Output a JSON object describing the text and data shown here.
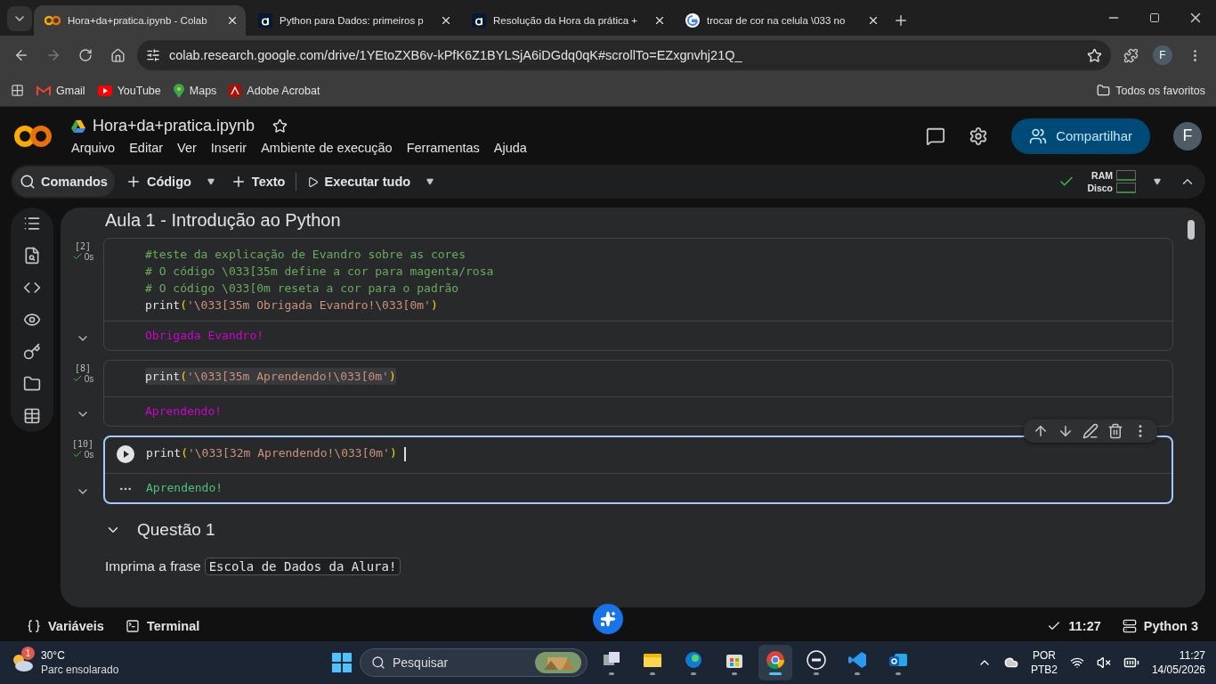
{
  "browser": {
    "tabs": [
      {
        "kind": "colab",
        "title": "Hora+da+pratica.ipynb - Colab",
        "selected": true
      },
      {
        "kind": "alura",
        "title": "Python para Dados: primeiros p",
        "selected": false
      },
      {
        "kind": "alura",
        "title": "Resolução da Hora da prática +",
        "selected": false
      },
      {
        "kind": "google",
        "title": "trocar de cor na celula \\033 no",
        "selected": false
      }
    ],
    "url": "colab.research.google.com/drive/1YEtoZXB6v-kPfK6Z1BYLSjA6iDGdq0qK#scrollTo=EZxgnvhj21Q_",
    "profile": "F",
    "bookmarks": [
      {
        "kind": "gmail",
        "label": "Gmail"
      },
      {
        "kind": "youtube",
        "label": "YouTube"
      },
      {
        "kind": "maps",
        "label": "Maps"
      },
      {
        "kind": "acrobat",
        "label": "Adobe Acrobat"
      }
    ],
    "all_bookmarks": "Todos os favoritos"
  },
  "colab": {
    "title": "Hora+da+pratica.ipynb",
    "menu": [
      "Arquivo",
      "Editar",
      "Ver",
      "Inserir",
      "Ambiente de execução",
      "Ferramentas",
      "Ajuda"
    ],
    "share": "Compartilhar",
    "avatar": "F",
    "toolbar": {
      "commands": "Comandos",
      "code": "Código",
      "text": "Texto",
      "run_all": "Executar tudo",
      "ram": "RAM",
      "disk": "Disco"
    }
  },
  "notebook": {
    "heading": "Aula 1 - Introdução ao Python",
    "cells": [
      {
        "count": "[2]",
        "time": "0s",
        "selected": false,
        "lines": [
          {
            "highlighted": false,
            "tokens": [
              {
                "kind": "comment",
                "text": "#teste da explicação de Evandro sobre as cores"
              }
            ]
          },
          {
            "highlighted": false,
            "tokens": [
              {
                "kind": "comment",
                "text": "# O código \\033[35m define a cor para magenta/rosa"
              }
            ]
          },
          {
            "highlighted": false,
            "tokens": [
              {
                "kind": "comment",
                "text": "# O código \\033[0m reseta a cor para o padrão"
              }
            ]
          },
          {
            "highlighted": false,
            "tokens": [
              {
                "kind": "func",
                "text": "print"
              },
              {
                "kind": "paren",
                "text": "("
              },
              {
                "kind": "string",
                "text": "'\\033[35m Obrigada Evandro!\\033[0m'"
              },
              {
                "kind": "paren",
                "text": ")"
              }
            ]
          }
        ],
        "output": {
          "text": "Obrigada Evandro!",
          "color": "#d200d2"
        }
      },
      {
        "count": "[8]",
        "time": "0s",
        "selected": false,
        "lines": [
          {
            "highlighted": true,
            "tokens": [
              {
                "kind": "func",
                "text": "print"
              },
              {
                "kind": "paren",
                "text": "("
              },
              {
                "kind": "string",
                "text": "'\\033[35m Aprendendo!\\033[0m'"
              },
              {
                "kind": "paren",
                "text": ")"
              }
            ]
          }
        ],
        "output": {
          "text": "Aprendendo!",
          "color": "#d200d2"
        }
      },
      {
        "count": "[10]",
        "time": "0s",
        "selected": true,
        "lines": [
          {
            "highlighted": false,
            "tokens": [
              {
                "kind": "func",
                "text": "print"
              },
              {
                "kind": "paren",
                "text": "("
              },
              {
                "kind": "string",
                "text": "'\\033[32m Aprendendo!\\033[0m'"
              },
              {
                "kind": "paren",
                "text": ")"
              }
            ]
          }
        ],
        "output": {
          "text": "Aprendendo!",
          "color": "#4ec27a"
        }
      }
    ],
    "section": "Questão 1",
    "paragraph": {
      "text": "Imprima a frase",
      "code": "Escola de Dados da Alura!"
    }
  },
  "status_bar": {
    "variables": "Variáveis",
    "terminal": "Terminal",
    "time": "11:27",
    "runtime": "Python 3"
  },
  "taskbar": {
    "weather": {
      "badge": "1",
      "temp": "30°C",
      "desc": "Parc ensolarado"
    },
    "search": "Pesquisar",
    "apps": [
      {
        "kind": "taskview",
        "active": false
      },
      {
        "kind": "explorer",
        "active": false
      },
      {
        "kind": "edge",
        "active": false
      },
      {
        "kind": "store",
        "active": false
      },
      {
        "kind": "chrome",
        "active": true
      },
      {
        "kind": "dell",
        "active": false
      },
      {
        "kind": "vscode",
        "active": false
      },
      {
        "kind": "outlook",
        "active": false
      }
    ],
    "lang": "POR",
    "layout": "PTB2",
    "time": "11:27",
    "date": "14/05/2026"
  }
}
